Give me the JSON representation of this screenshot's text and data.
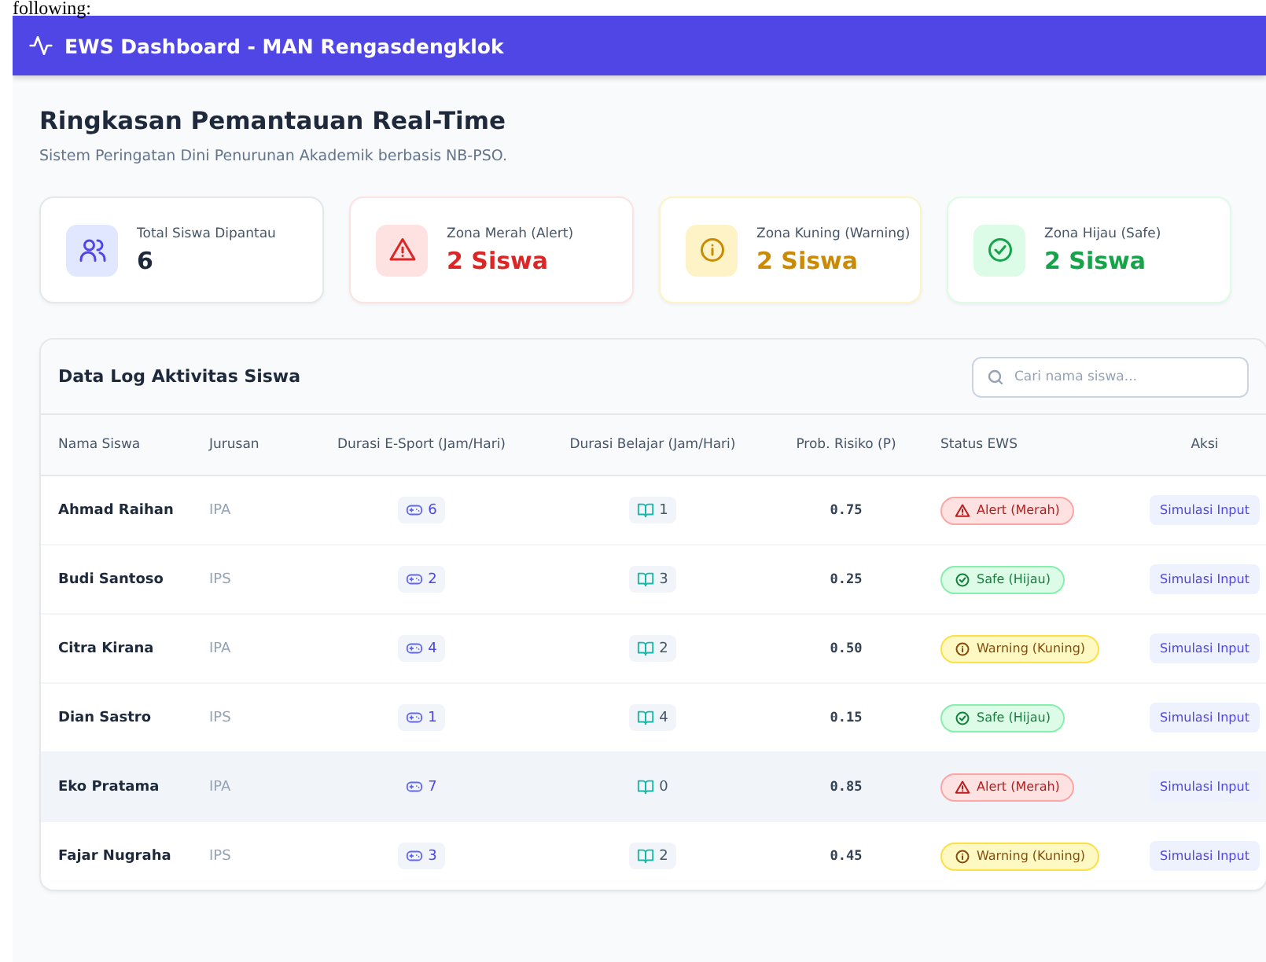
{
  "caption": "following:",
  "header": {
    "title": "EWS Dashboard - MAN Rengasdengklok"
  },
  "summary": {
    "title": "Ringkasan Pemantauan Real-Time",
    "subtitle": "Sistem Peringatan Dini Penurunan Akademik berbasis NB-PSO."
  },
  "cards": [
    {
      "kind": "total",
      "label": "Total Siswa Dipantau",
      "value": "6"
    },
    {
      "kind": "alert",
      "label": "Zona Merah (Alert)",
      "value": "2 Siswa"
    },
    {
      "kind": "warning",
      "label": "Zona Kuning (Warning)",
      "value": "2 Siswa"
    },
    {
      "kind": "safe",
      "label": "Zona Hijau (Safe)",
      "value": "2 Siswa"
    }
  ],
  "table": {
    "title": "Data Log Aktivitas Siswa",
    "search": {
      "placeholder": "Cari nama siswa..."
    },
    "columns": [
      "Nama Siswa",
      "Jurusan",
      "Durasi E-Sport (Jam/Hari)",
      "Durasi Belajar (Jam/Hari)",
      "Prob. Risiko (P)",
      "Status EWS",
      "Aksi"
    ],
    "rows": [
      {
        "name": "Ahmad Raihan",
        "major": "IPA",
        "esport": "6",
        "study": "1",
        "prob": "0.75",
        "status": {
          "kind": "alert",
          "label": "Alert (Merah)"
        },
        "action": "Simulasi Input",
        "highlighted": false
      },
      {
        "name": "Budi Santoso",
        "major": "IPS",
        "esport": "2",
        "study": "3",
        "prob": "0.25",
        "status": {
          "kind": "safe",
          "label": "Safe (Hijau)"
        },
        "action": "Simulasi Input",
        "highlighted": false
      },
      {
        "name": "Citra Kirana",
        "major": "IPA",
        "esport": "4",
        "study": "2",
        "prob": "0.50",
        "status": {
          "kind": "warning",
          "label": "Warning (Kuning)"
        },
        "action": "Simulasi Input",
        "highlighted": false
      },
      {
        "name": "Dian Sastro",
        "major": "IPS",
        "esport": "1",
        "study": "4",
        "prob": "0.15",
        "status": {
          "kind": "safe",
          "label": "Safe (Hijau)"
        },
        "action": "Simulasi Input",
        "highlighted": false
      },
      {
        "name": "Eko Pratama",
        "major": "IPA",
        "esport": "7",
        "study": "0",
        "prob": "0.85",
        "status": {
          "kind": "alert",
          "label": "Alert (Merah)"
        },
        "action": "Simulasi Input",
        "highlighted": true
      },
      {
        "name": "Fajar Nugraha",
        "major": "IPS",
        "esport": "3",
        "study": "2",
        "prob": "0.45",
        "status": {
          "kind": "warning",
          "label": "Warning (Kuning)"
        },
        "action": "Simulasi Input",
        "highlighted": false
      }
    ]
  }
}
